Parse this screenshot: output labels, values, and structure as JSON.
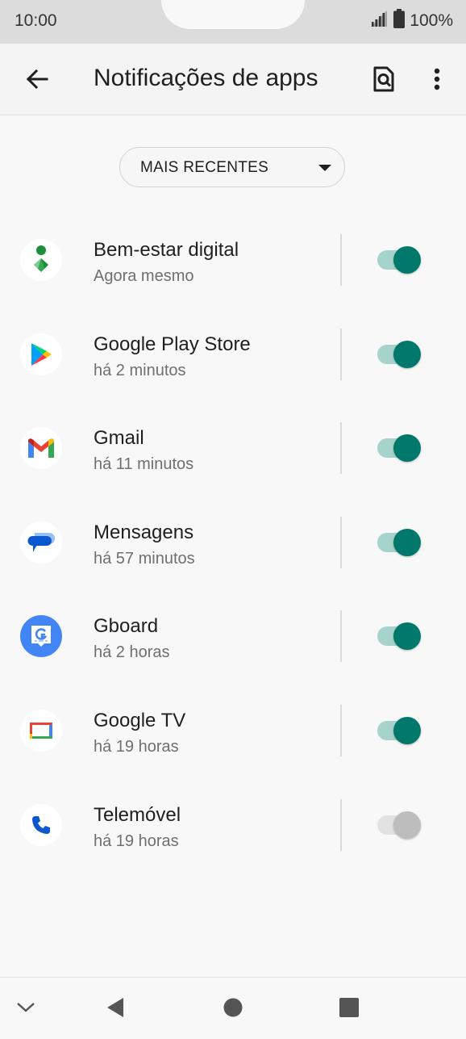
{
  "status_bar": {
    "time": "10:00",
    "battery": "100%"
  },
  "app_bar": {
    "title": "Notificações de apps",
    "back_icon": "arrow-back-icon",
    "search_icon": "search-settings-icon",
    "more_icon": "more-vert-icon"
  },
  "filter": {
    "selected": "MAIS RECENTES"
  },
  "apps": [
    {
      "name": "Bem-estar digital",
      "time": "Agora mesmo",
      "icon": "digital-wellbeing-icon",
      "enabled": true
    },
    {
      "name": "Google Play Store",
      "time": "há 2 minutos",
      "icon": "play-store-icon",
      "enabled": true
    },
    {
      "name": "Gmail",
      "time": "há 11 minutos",
      "icon": "gmail-icon",
      "enabled": true
    },
    {
      "name": "Mensagens",
      "time": "há 57 minutos",
      "icon": "messages-icon",
      "enabled": true
    },
    {
      "name": "Gboard",
      "time": "há 2 horas",
      "icon": "gboard-icon",
      "enabled": true
    },
    {
      "name": "Google TV",
      "time": "há 19 horas",
      "icon": "google-tv-icon",
      "enabled": true
    },
    {
      "name": "Telemóvel",
      "time": "há 19 horas",
      "icon": "phone-icon",
      "enabled": false
    }
  ],
  "colors": {
    "toggle_on_thumb": "#00786b",
    "toggle_on_track": "#a6d3cc",
    "toggle_off_thumb": "#bdbdbd",
    "toggle_off_track": "#e2e2e2"
  }
}
